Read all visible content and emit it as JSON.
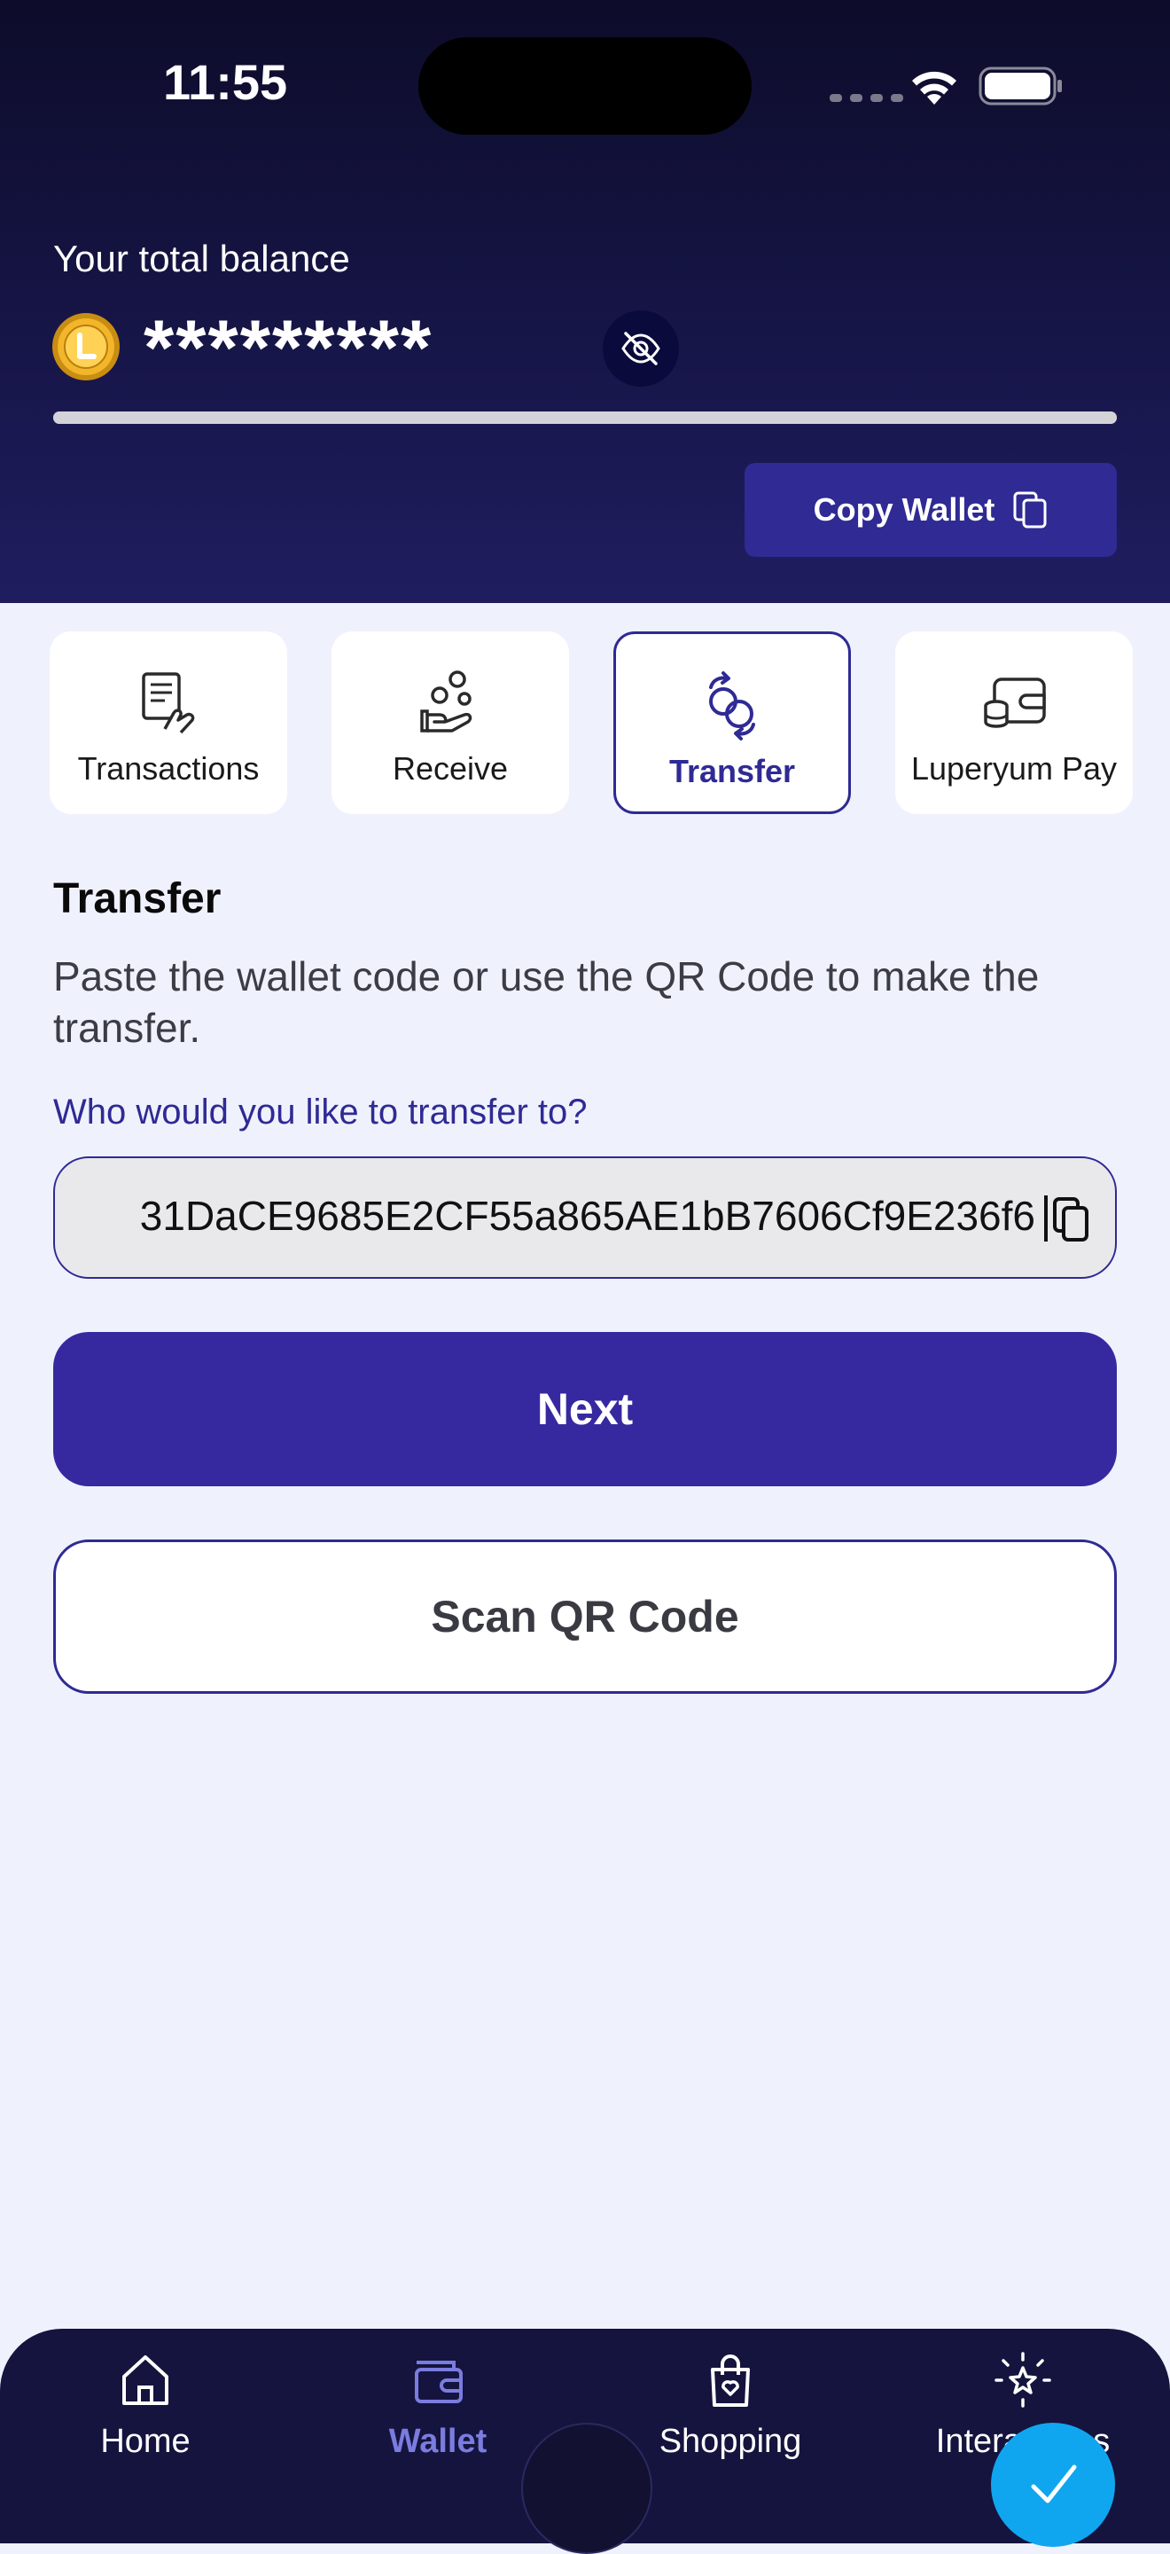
{
  "status_bar": {
    "time": "11:55"
  },
  "balance": {
    "label": "Your total balance",
    "masked_value": "*********",
    "progress": 1.0
  },
  "copy_wallet": {
    "label": "Copy Wallet"
  },
  "tabs": [
    {
      "label": "Transactions",
      "icon": "transactions-icon"
    },
    {
      "label": "Receive",
      "icon": "receive-icon"
    },
    {
      "label": "Transfer",
      "icon": "transfer-icon",
      "active": true
    },
    {
      "label": "Luperyum Pay",
      "icon": "wallet-pay-icon"
    }
  ],
  "transfer": {
    "title": "Transfer",
    "description": "Paste the wallet code or use the QR Code to make the transfer.",
    "field_label": "Who would you like to transfer to?",
    "wallet_code": "31DaCE9685E2CF55a865AE1bB7606Cf9E236f6",
    "next_label": "Next",
    "scan_label": "Scan QR Code"
  },
  "nav": [
    {
      "label": "Home",
      "icon": "home-icon"
    },
    {
      "label": "Wallet",
      "icon": "wallet-icon",
      "active": true
    },
    {
      "label": "Shopping",
      "icon": "shopping-bag-icon"
    },
    {
      "label": "Interactions",
      "icon": "interactions-icon"
    }
  ],
  "colors": {
    "accent": "#2f2a94",
    "primary_button": "#3629a0",
    "header_dark": "#17164a",
    "page_background": "#eff2fd",
    "fab": "#10a6ef"
  }
}
